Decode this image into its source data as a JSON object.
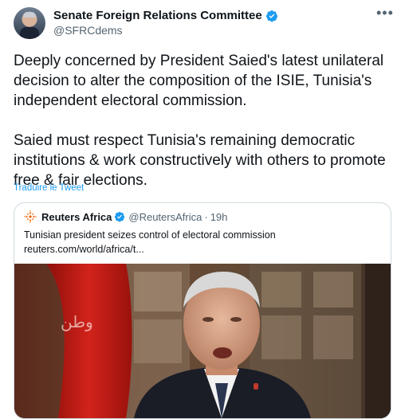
{
  "account": {
    "name": "Senate Foreign Relations Committee",
    "handle": "@SFRCdems",
    "more_icon": "more-horizontal-icon",
    "verified_color": "#1d9bf0"
  },
  "tweet": {
    "text": "Deeply concerned by President Saied's latest unilateral decision to alter the composition of the ISIE, Tunisia's independent electoral commission.\n\nSaied must respect Tunisia's remaining democratic institutions & work constructively with others to promote free & fair elections.",
    "translate_label": "Traduire le Tweet"
  },
  "quote": {
    "name": "Reuters Africa",
    "handle": "@ReutersAfrica",
    "separator": "·",
    "time": "19h",
    "text": "Tunisian president seizes control of electoral commission",
    "link": "reuters.com/world/africa/t..."
  },
  "image": {
    "flag_text": "وطن"
  }
}
